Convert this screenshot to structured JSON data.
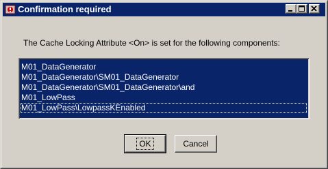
{
  "window": {
    "title": "Confirmation required",
    "icon": "app-warning-icon",
    "controls": {
      "minimize": "minimize-icon",
      "maximize": "maximize-icon",
      "close": "close-icon"
    }
  },
  "message": "The Cache Locking Attribute <On> is set for the following components:",
  "components": [
    "M01_DataGenerator",
    "M01_DataGenerator\\SM01_DataGenerator",
    "M01_DataGenerator\\SM01_DataGenerator\\and",
    "M01_LowPass",
    "M01_LowPass\\LowpassKEnabled"
  ],
  "buttons": {
    "ok": "OK",
    "cancel": "Cancel"
  },
  "colors": {
    "titlebar": "#0a246a",
    "selection": "#0a246a",
    "face": "#d4d0c8"
  }
}
